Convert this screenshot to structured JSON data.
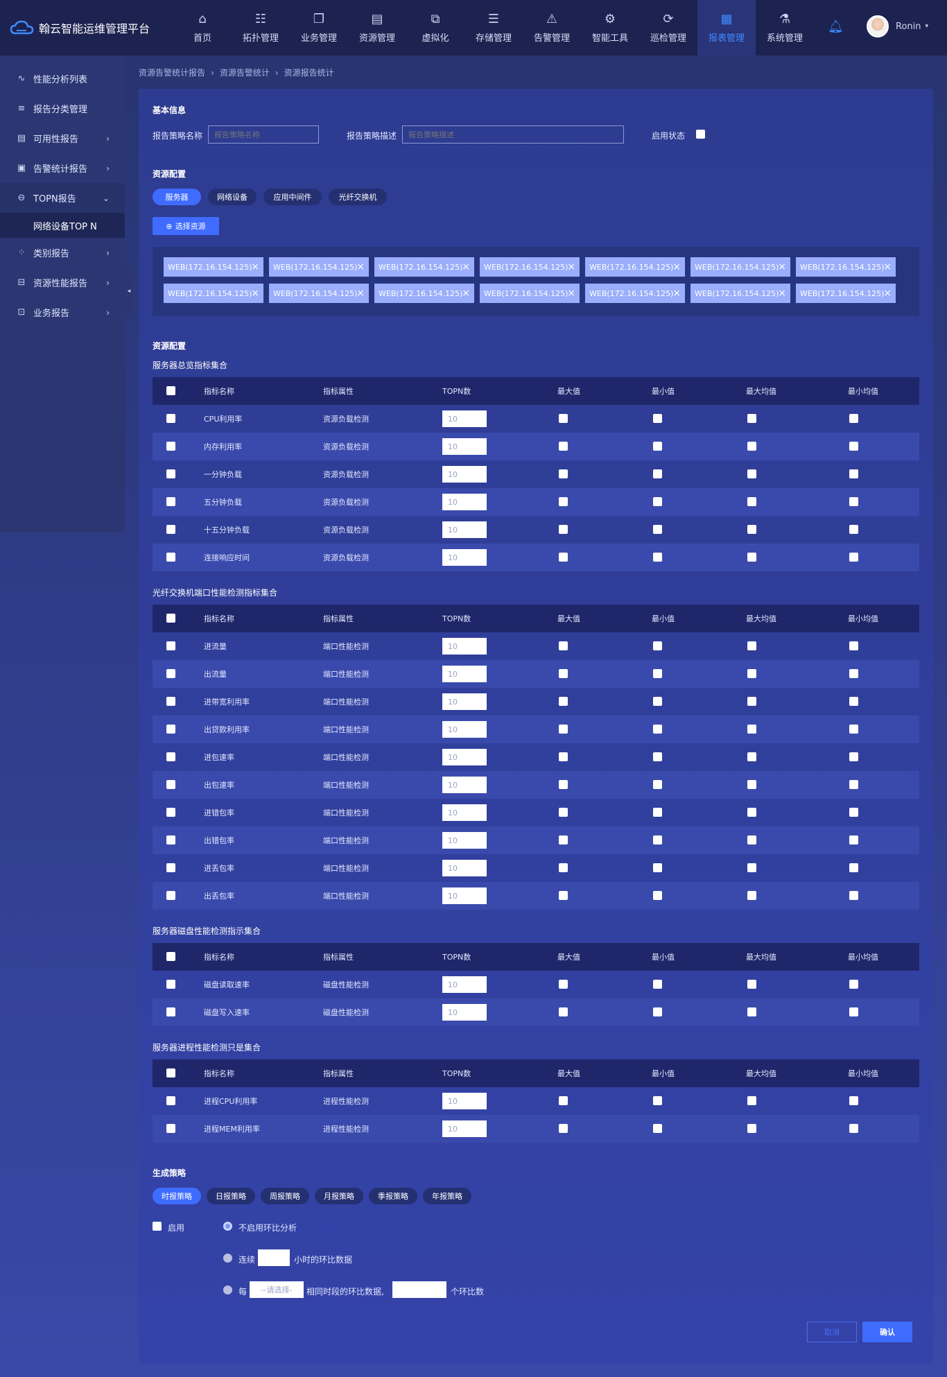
{
  "app": {
    "title": "翰云智能运维管理平台"
  },
  "nav": [
    {
      "icon": "home-icon",
      "glyph": "⌂",
      "label": "首页"
    },
    {
      "icon": "topology-icon",
      "glyph": "☷",
      "label": "拓扑管理"
    },
    {
      "icon": "business-icon",
      "glyph": "❐",
      "label": "业务管理"
    },
    {
      "icon": "resource-icon",
      "glyph": "▤",
      "label": "资源管理"
    },
    {
      "icon": "virtual-icon",
      "glyph": "⧉",
      "label": "虚拟化"
    },
    {
      "icon": "storage-icon",
      "glyph": "☰",
      "label": "存储管理"
    },
    {
      "icon": "alarm-icon",
      "glyph": "⚠",
      "label": "告警管理"
    },
    {
      "icon": "tools-icon",
      "glyph": "⚙",
      "label": "智能工具"
    },
    {
      "icon": "inspect-icon",
      "glyph": "⟳",
      "label": "巡检管理"
    },
    {
      "icon": "report-icon",
      "glyph": "▦",
      "label": "报表管理"
    },
    {
      "icon": "system-icon",
      "glyph": "⚗",
      "label": "系统管理"
    }
  ],
  "user": {
    "name": "Ronin"
  },
  "sidebar": [
    {
      "icon": "pulse-icon",
      "glyph": "∿",
      "label": "性能分析列表",
      "arrow": ""
    },
    {
      "icon": "list-icon",
      "glyph": "≡",
      "label": "报告分类管理",
      "arrow": ""
    },
    {
      "icon": "doc-icon",
      "glyph": "▤",
      "label": "可用性报告",
      "arrow": "›"
    },
    {
      "icon": "screen-icon",
      "glyph": "▣",
      "label": "告警统计报告",
      "arrow": "›"
    },
    {
      "icon": "topn-icon",
      "glyph": "⊖",
      "label": "TOPN报告",
      "arrow": "⌄"
    },
    {
      "icon": "category-icon",
      "glyph": "⁘",
      "label": "类别报告",
      "arrow": "›"
    },
    {
      "icon": "perf-icon",
      "glyph": "⊟",
      "label": "资源性能报告",
      "arrow": "›"
    },
    {
      "icon": "briefcase-icon",
      "glyph": "⊡",
      "label": "业务报告",
      "arrow": "›"
    }
  ],
  "sidebar_sub": "网络设备TOP N",
  "breadcrumb": [
    "资源告警统计报告",
    "资源告警统计",
    "资源报告统计"
  ],
  "basic": {
    "title": "基本信息",
    "name_label": "报告策略名称",
    "name_placeholder": "报告策略名称",
    "desc_label": "报告策略描述",
    "desc_placeholder": "报告策略描述",
    "enable_label": "启用状态"
  },
  "resource": {
    "title": "资源配置",
    "tabs": [
      "服务器",
      "网络设备",
      "应用中间件",
      "光纤交换机"
    ],
    "select_btn": "选择资源",
    "tags": [
      "WEB(172.16.154.125)",
      "WEB(172.16.154.125)",
      "WEB(172.16.154.125)",
      "WEB(172.16.154.125)",
      "WEB(172.16.154.125)",
      "WEB(172.16.154.125)",
      "WEB(172.16.154.125)",
      "WEB(172.16.154.125)",
      "WEB(172.16.154.125)",
      "WEB(172.16.154.125)",
      "WEB(172.16.154.125)",
      "WEB(172.16.154.125)",
      "WEB(172.16.154.125)",
      "WEB(172.16.154.125)"
    ]
  },
  "config_title": "资源配置",
  "headers": [
    "指标名称",
    "指标属性",
    "TOPN数",
    "最大值",
    "最小值",
    "最大均值",
    "最小均值"
  ],
  "tables": [
    {
      "title": "服务器总览指标集合",
      "attr": "资源负载检测",
      "rows": [
        "CPU利用率",
        "内存利用率",
        "一分钟负载",
        "五分钟负载",
        "十五分钟负载",
        "连接响应时间"
      ]
    },
    {
      "title": "光纤交换机端口性能检测指标集合",
      "attr": "端口性能检测",
      "rows": [
        "进流量",
        "出流量",
        "进带宽利用率",
        "出贷款利用率",
        "进包速率",
        "出包速率",
        "进错包率",
        "出错包率",
        "进丢包率",
        "出丢包率"
      ]
    },
    {
      "title": "服务器磁盘性能检测指示集合",
      "attr": "磁盘性能检测",
      "rows": [
        "磁盘读取速率",
        "磁盘写入速率"
      ]
    },
    {
      "title": "服务器进程性能检测只是集合",
      "attr": "进程性能检测",
      "rows": [
        "进程CPU利用率",
        "进程MEM利用率"
      ]
    }
  ],
  "topn_value": "10",
  "strategy": {
    "title": "生成策略",
    "tabs": [
      "时报策略",
      "日报策略",
      "周报策略",
      "月报策略",
      "季报策略",
      "年报策略"
    ],
    "enable_label": "启用",
    "opt1": "不启用环比分析",
    "opt2_pre": "连续",
    "opt2_post": "小时的环比数据",
    "opt3_pre": "每",
    "opt3_select": "--请选择-",
    "opt3_mid": "相同时段的环比数据,",
    "opt3_post": "个环比数"
  },
  "buttons": {
    "cancel": "取消",
    "confirm": "确认"
  }
}
